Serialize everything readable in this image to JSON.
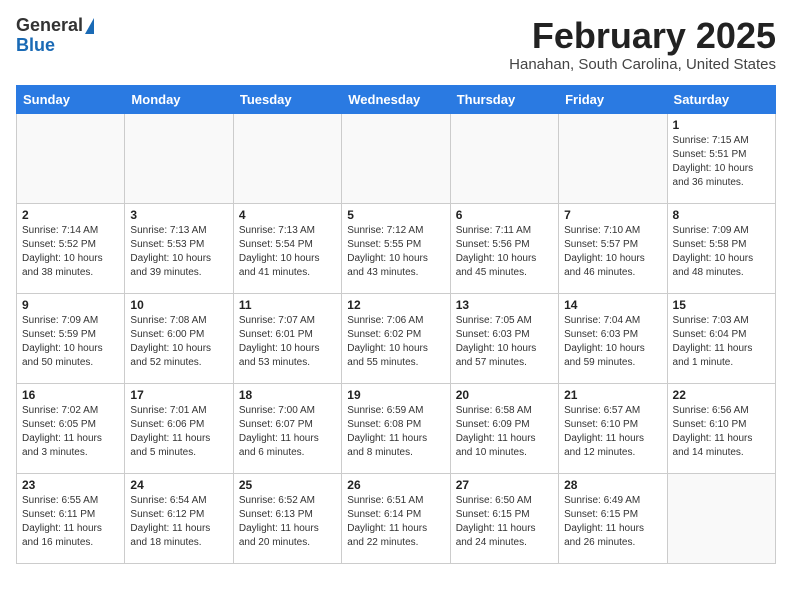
{
  "header": {
    "logo_general": "General",
    "logo_blue": "Blue",
    "month_title": "February 2025",
    "location": "Hanahan, South Carolina, United States"
  },
  "weekdays": [
    "Sunday",
    "Monday",
    "Tuesday",
    "Wednesday",
    "Thursday",
    "Friday",
    "Saturday"
  ],
  "days": [
    {
      "num": "",
      "info": ""
    },
    {
      "num": "",
      "info": ""
    },
    {
      "num": "",
      "info": ""
    },
    {
      "num": "",
      "info": ""
    },
    {
      "num": "",
      "info": ""
    },
    {
      "num": "",
      "info": ""
    },
    {
      "num": "1",
      "info": "Sunrise: 7:15 AM\nSunset: 5:51 PM\nDaylight: 10 hours\nand 36 minutes."
    },
    {
      "num": "2",
      "info": "Sunrise: 7:14 AM\nSunset: 5:52 PM\nDaylight: 10 hours\nand 38 minutes."
    },
    {
      "num": "3",
      "info": "Sunrise: 7:13 AM\nSunset: 5:53 PM\nDaylight: 10 hours\nand 39 minutes."
    },
    {
      "num": "4",
      "info": "Sunrise: 7:13 AM\nSunset: 5:54 PM\nDaylight: 10 hours\nand 41 minutes."
    },
    {
      "num": "5",
      "info": "Sunrise: 7:12 AM\nSunset: 5:55 PM\nDaylight: 10 hours\nand 43 minutes."
    },
    {
      "num": "6",
      "info": "Sunrise: 7:11 AM\nSunset: 5:56 PM\nDaylight: 10 hours\nand 45 minutes."
    },
    {
      "num": "7",
      "info": "Sunrise: 7:10 AM\nSunset: 5:57 PM\nDaylight: 10 hours\nand 46 minutes."
    },
    {
      "num": "8",
      "info": "Sunrise: 7:09 AM\nSunset: 5:58 PM\nDaylight: 10 hours\nand 48 minutes."
    },
    {
      "num": "9",
      "info": "Sunrise: 7:09 AM\nSunset: 5:59 PM\nDaylight: 10 hours\nand 50 minutes."
    },
    {
      "num": "10",
      "info": "Sunrise: 7:08 AM\nSunset: 6:00 PM\nDaylight: 10 hours\nand 52 minutes."
    },
    {
      "num": "11",
      "info": "Sunrise: 7:07 AM\nSunset: 6:01 PM\nDaylight: 10 hours\nand 53 minutes."
    },
    {
      "num": "12",
      "info": "Sunrise: 7:06 AM\nSunset: 6:02 PM\nDaylight: 10 hours\nand 55 minutes."
    },
    {
      "num": "13",
      "info": "Sunrise: 7:05 AM\nSunset: 6:03 PM\nDaylight: 10 hours\nand 57 minutes."
    },
    {
      "num": "14",
      "info": "Sunrise: 7:04 AM\nSunset: 6:03 PM\nDaylight: 10 hours\nand 59 minutes."
    },
    {
      "num": "15",
      "info": "Sunrise: 7:03 AM\nSunset: 6:04 PM\nDaylight: 11 hours\nand 1 minute."
    },
    {
      "num": "16",
      "info": "Sunrise: 7:02 AM\nSunset: 6:05 PM\nDaylight: 11 hours\nand 3 minutes."
    },
    {
      "num": "17",
      "info": "Sunrise: 7:01 AM\nSunset: 6:06 PM\nDaylight: 11 hours\nand 5 minutes."
    },
    {
      "num": "18",
      "info": "Sunrise: 7:00 AM\nSunset: 6:07 PM\nDaylight: 11 hours\nand 6 minutes."
    },
    {
      "num": "19",
      "info": "Sunrise: 6:59 AM\nSunset: 6:08 PM\nDaylight: 11 hours\nand 8 minutes."
    },
    {
      "num": "20",
      "info": "Sunrise: 6:58 AM\nSunset: 6:09 PM\nDaylight: 11 hours\nand 10 minutes."
    },
    {
      "num": "21",
      "info": "Sunrise: 6:57 AM\nSunset: 6:10 PM\nDaylight: 11 hours\nand 12 minutes."
    },
    {
      "num": "22",
      "info": "Sunrise: 6:56 AM\nSunset: 6:10 PM\nDaylight: 11 hours\nand 14 minutes."
    },
    {
      "num": "23",
      "info": "Sunrise: 6:55 AM\nSunset: 6:11 PM\nDaylight: 11 hours\nand 16 minutes."
    },
    {
      "num": "24",
      "info": "Sunrise: 6:54 AM\nSunset: 6:12 PM\nDaylight: 11 hours\nand 18 minutes."
    },
    {
      "num": "25",
      "info": "Sunrise: 6:52 AM\nSunset: 6:13 PM\nDaylight: 11 hours\nand 20 minutes."
    },
    {
      "num": "26",
      "info": "Sunrise: 6:51 AM\nSunset: 6:14 PM\nDaylight: 11 hours\nand 22 minutes."
    },
    {
      "num": "27",
      "info": "Sunrise: 6:50 AM\nSunset: 6:15 PM\nDaylight: 11 hours\nand 24 minutes."
    },
    {
      "num": "28",
      "info": "Sunrise: 6:49 AM\nSunset: 6:15 PM\nDaylight: 11 hours\nand 26 minutes."
    },
    {
      "num": "",
      "info": ""
    }
  ]
}
